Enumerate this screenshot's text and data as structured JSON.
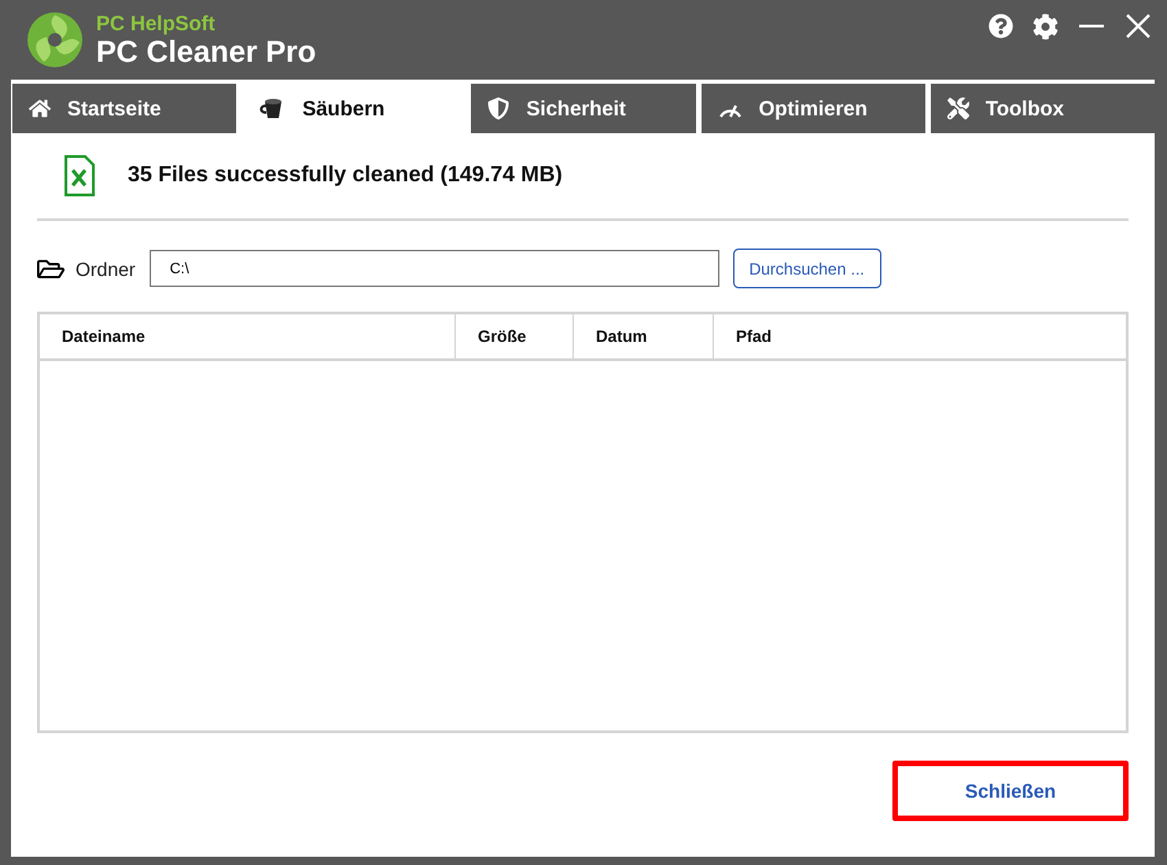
{
  "app": {
    "brand": "PC HelpSoft",
    "title": "PC Cleaner Pro"
  },
  "tabs": [
    {
      "label": "Startseite",
      "kind": "home",
      "selected": false
    },
    {
      "label": "Säubern",
      "kind": "clean",
      "selected": true
    },
    {
      "label": "Sicherheit",
      "kind": "shield",
      "selected": false
    },
    {
      "label": "Optimieren",
      "kind": "gauge",
      "selected": false
    },
    {
      "label": "Toolbox",
      "kind": "tools",
      "selected": false
    }
  ],
  "result": {
    "message": "35 Files successfully cleaned (149.74 MB)"
  },
  "folder": {
    "label": "Ordner",
    "value": "C:\\",
    "browse_button": "Durchsuchen ..."
  },
  "table": {
    "columns": [
      "Dateiname",
      "Größe",
      "Datum",
      "Pfad"
    ]
  },
  "close_button": "Schließen"
}
